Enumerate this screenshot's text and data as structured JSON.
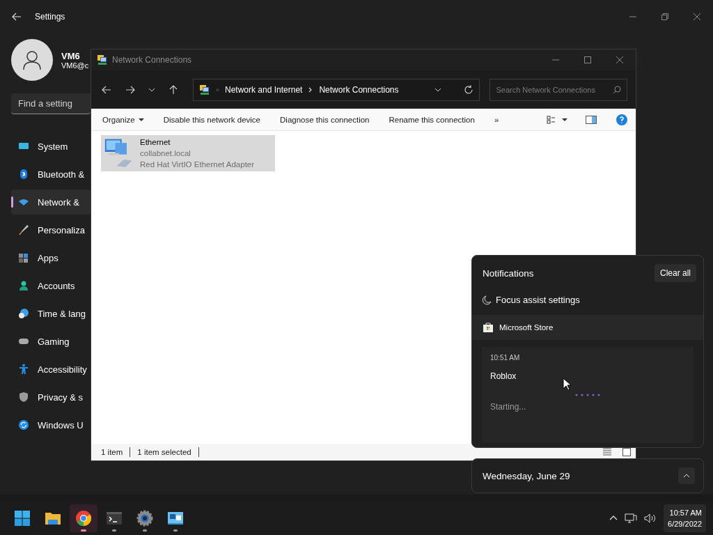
{
  "settings": {
    "title": "Settings",
    "user": {
      "name": "VM6",
      "email": "VM6@c"
    },
    "search": {
      "placeholder": "Find a setting"
    },
    "nav": [
      {
        "label": "System",
        "kind": "system",
        "selected": false
      },
      {
        "label": "Bluetooth &",
        "kind": "bluetooth",
        "selected": false
      },
      {
        "label": "Network &",
        "kind": "network",
        "selected": true
      },
      {
        "label": "Personaliza",
        "kind": "brush",
        "selected": false
      },
      {
        "label": "Apps",
        "kind": "apps",
        "selected": false
      },
      {
        "label": "Accounts",
        "kind": "accounts",
        "selected": false
      },
      {
        "label": "Time & lang",
        "kind": "time",
        "selected": false
      },
      {
        "label": "Gaming",
        "kind": "gaming",
        "selected": false
      },
      {
        "label": "Accessibility",
        "kind": "accessibility",
        "selected": false
      },
      {
        "label": "Privacy & s",
        "kind": "privacy",
        "selected": false
      },
      {
        "label": "Windows U",
        "kind": "update",
        "selected": false
      }
    ]
  },
  "explorer": {
    "title": "Network Connections",
    "address": {
      "overflow": "«",
      "crumbs": [
        "Network and Internet",
        "Network Connections"
      ]
    },
    "search": {
      "placeholder": "Search Network Connections"
    },
    "commands": [
      {
        "label": "Organize",
        "kind": "menu"
      },
      {
        "label": "Disable this network device",
        "kind": "action"
      },
      {
        "label": "Diagnose this connection",
        "kind": "action"
      },
      {
        "label": "Rename this connection",
        "kind": "action"
      },
      {
        "label": "»",
        "kind": "more"
      }
    ],
    "items": [
      {
        "name": "Ethernet",
        "lines": [
          "collabnet.local",
          "Red Hat VirtIO Ethernet Adapter"
        ],
        "selected": true
      }
    ],
    "status": [
      "1 item",
      "1 item selected"
    ]
  },
  "notifications": {
    "title": "Notifications",
    "clear_button": "Clear all",
    "focus_assist": "Focus assist settings",
    "groups": [
      {
        "app": "Microsoft Store",
        "items": [
          {
            "time": "10:51 AM",
            "title": "Roblox",
            "status": "Starting..."
          }
        ]
      }
    ]
  },
  "calendar": {
    "date": "Wednesday, June 29"
  },
  "taskbar": {
    "apps": [
      {
        "kind": "start",
        "selected": false,
        "running": false
      },
      {
        "kind": "folder",
        "selected": false,
        "running": false
      },
      {
        "kind": "chrome",
        "selected": true,
        "running": true
      },
      {
        "kind": "terminal",
        "selected": false,
        "running": true
      },
      {
        "kind": "settings",
        "selected": false,
        "running": true
      },
      {
        "kind": "network",
        "selected": false,
        "running": true
      }
    ],
    "clock": {
      "time": "10:57 AM",
      "date": "6/29/2022"
    }
  }
}
